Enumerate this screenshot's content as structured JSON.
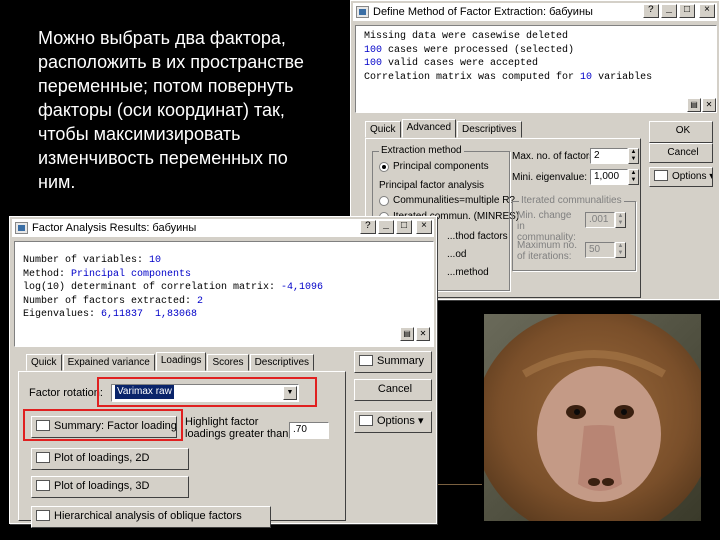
{
  "caption": "Можно выбрать два фактора,\nрасположить в их пространстве\nпеременные; потом повернуть\nфакторы (оси координат) так,\nчтобы максимизировать\nизменчивость переменных по\nним.",
  "back_window": {
    "title": "Define Method of Factor Extraction: бабуины",
    "output": {
      "l1": "Missing data were casewise deleted",
      "l2_num": "100",
      "l2_txt": " cases were processed (selected)",
      "l3_num": "100",
      "l3_txt": " valid cases were accepted",
      "l4_txt": "Correlation matrix was computed for ",
      "l4_num": "10",
      "l4_end": " variables"
    },
    "tabs": [
      "Quick",
      "Advanced",
      "Descriptives"
    ],
    "ok_label": "OK",
    "cancel_label": "Cancel",
    "options_label": "Options",
    "extraction_method_label": "Extraction method",
    "principal_components": "Principal components",
    "principal_factor_analysis": "Principal factor analysis",
    "communalities_multiple": "Communalities=multiple R?",
    "iterated_commun": "Iterated commun. (MINRES)",
    "centroid": "...thod factors",
    "max_factors_label": "Max. no. of factors:",
    "max_factors_value": "2",
    "min_eigen_label": "Mini. eigenvalue:",
    "min_eigen_value": "1,000",
    "iterated_comm_label": "Iterated communalities",
    "min_change_label": "Min. change in communality:",
    "min_change_value": ".001",
    "max_iter_label": "Maximum no. of iterations:",
    "max_iter_value": "50",
    "partial_1": "...od",
    "partial_2": "...method"
  },
  "front_window": {
    "title": "Factor Analysis Results: бабуины",
    "output": {
      "l1_txt": "Number of variables: ",
      "l1_val": "10",
      "l2_txt": "Method: ",
      "l2_val": "Principal components",
      "l3_txt": "log(10) determinant of correlation matrix: ",
      "l3_val": "-4,1096",
      "l4_txt": "Number of factors extracted: ",
      "l4_val": "2",
      "l5_txt": "Eigenvalues: ",
      "l5_val": "6,11837  1,83068"
    },
    "tabs": [
      "Quick",
      "Expained variance",
      "Loadings",
      "Scores",
      "Descriptives"
    ],
    "summary_label": "Summary",
    "cancel_label": "Cancel",
    "options_label": "Options",
    "factor_rotation_label": "Factor rotation:",
    "factor_rotation_value": "Varimax raw",
    "summary_factor_loadings": "Summary: Factor loadings",
    "highlight_label_1": "Highlight factor",
    "highlight_label_2": "loadings greater than:",
    "highlight_value": ".70",
    "plot_2d": "Plot of loadings, 2D",
    "plot_3d": "Plot of loadings, 3D",
    "hierarchical": "Hierarchical analysis of oblique factors"
  },
  "colors": {
    "highlight_box": "#e02020",
    "output_values": "#0000c8",
    "selection": "#0a246a"
  }
}
